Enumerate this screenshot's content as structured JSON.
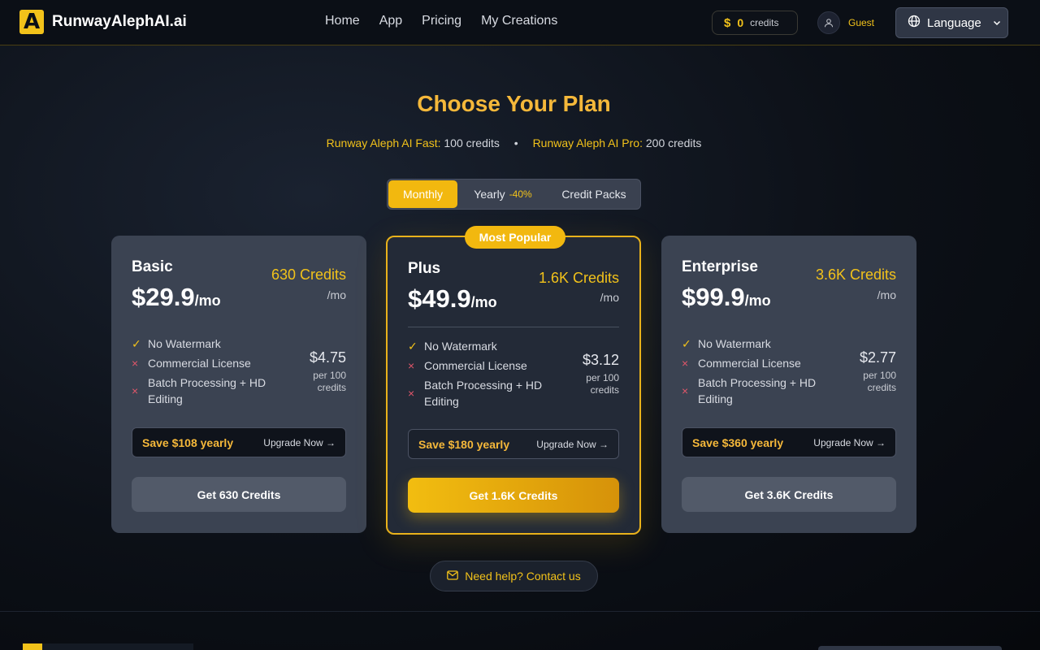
{
  "brand": {
    "logo_letter": "A",
    "name": "RunwayAlephAI.ai"
  },
  "nav": [
    "Home",
    "App",
    "Pricing",
    "My Creations"
  ],
  "credits": {
    "symbol": "$",
    "count": "0",
    "label": "credits"
  },
  "user": {
    "name": "Guest"
  },
  "language": {
    "label": "Language"
  },
  "hero": {
    "title": "Choose Your Plan",
    "fast_label": "Runway Aleph AI Fast:",
    "fast_value": "100 credits",
    "sep": "•",
    "pro_label": "Runway Aleph AI Pro:",
    "pro_value": "200 credits"
  },
  "tabs": {
    "monthly": "Monthly",
    "yearly": "Yearly",
    "yearly_off": "-40%",
    "packs": "Credit Packs"
  },
  "plans": [
    {
      "name": "Basic",
      "price": "$29.9",
      "per": "/mo",
      "credits": "630 Credits",
      "credits_per": "/mo",
      "features": [
        "No Watermark",
        "Commercial License",
        "Batch Processing + HD Editing"
      ],
      "unit_price": "$4.75",
      "unit_label": "per 100 credits",
      "save": "Save $108 yearly",
      "upgrade": "Upgrade Now →",
      "cta": "Get 630 Credits"
    },
    {
      "name": "Plus",
      "badge": "Most Popular",
      "price": "$49.9",
      "per": "/mo",
      "credits": "1.6K Credits",
      "credits_per": "/mo",
      "features": [
        "No Watermark",
        "Commercial License",
        "Batch Processing + HD Editing"
      ],
      "unit_price": "$3.12",
      "unit_label": "per 100 credits",
      "save": "Save $180 yearly",
      "upgrade": "Upgrade Now →",
      "cta": "Get 1.6K Credits"
    },
    {
      "name": "Enterprise",
      "price": "$99.9",
      "per": "/mo",
      "credits": "3.6K Credits",
      "credits_per": "/mo",
      "features": [
        "No Watermark",
        "Commercial License",
        "Batch Processing + HD Editing"
      ],
      "unit_price": "$2.77",
      "unit_label": "per 100 credits",
      "save": "Save $360 yearly",
      "upgrade": "Upgrade Now →",
      "cta": "Get 3.6K Credits"
    }
  ],
  "icons": {
    "check": "✓",
    "cross": "×"
  },
  "help": {
    "label": "Need help? Contact us"
  },
  "colors": {
    "accent": "#f2b80f",
    "title": "#f5b83a",
    "negative": "#e0566a"
  }
}
